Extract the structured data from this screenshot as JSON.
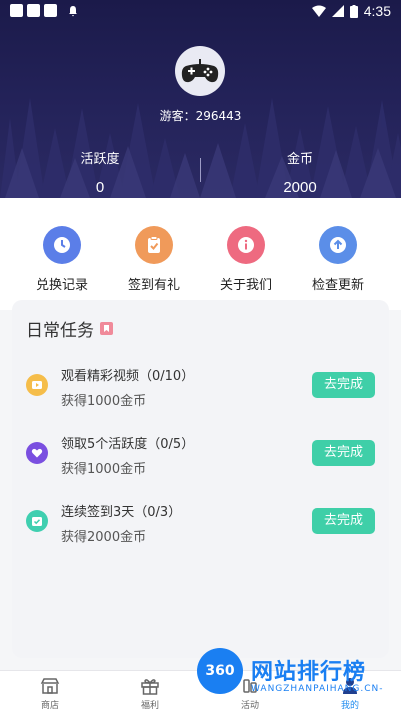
{
  "status_bar": {
    "time": "4:35"
  },
  "profile": {
    "guest_label": "游客：296443"
  },
  "stats": {
    "activity_label": "活跃度",
    "activity_value": "0",
    "coins_label": "金币",
    "coins_value": "2000"
  },
  "quick_actions": [
    {
      "label": "兑换记录",
      "icon": "clock-icon",
      "color": "#5b7ee8"
    },
    {
      "label": "签到有礼",
      "icon": "clipboard-check-icon",
      "color": "#f09a5a"
    },
    {
      "label": "关于我们",
      "icon": "info-icon",
      "color": "#ee6a80"
    },
    {
      "label": "检查更新",
      "icon": "upload-icon",
      "color": "#5b8ee8"
    }
  ],
  "daily_tasks": {
    "title": "日常任务",
    "items": [
      {
        "title": "观看精彩视频（0/10）",
        "reward": "获得1000金币",
        "button": "去完成",
        "icon": "video-play-icon",
        "color": "#f5bd4a"
      },
      {
        "title": "领取5个活跃度（0/5）",
        "reward": "获得1000金币",
        "button": "去完成",
        "icon": "heart-icon",
        "color": "#7a4fe0"
      },
      {
        "title": "连续签到3天（0/3）",
        "reward": "获得2000金币",
        "button": "去完成",
        "icon": "calendar-check-icon",
        "color": "#3fcfb0"
      }
    ]
  },
  "bottom_nav": [
    {
      "label": "商店",
      "icon": "store-icon"
    },
    {
      "label": "福利",
      "icon": "gift-icon"
    },
    {
      "label": "活动",
      "icon": "activity-icon"
    },
    {
      "label": "我的",
      "icon": "profile-icon"
    }
  ],
  "watermark": {
    "badge": "360",
    "name": "网站排行榜",
    "url": "WANGZHANPAIHANG.CN-"
  },
  "colors": {
    "header_bg": "#1b1a4a",
    "accent_green": "#3fcfa8",
    "nav_active": "#1f8cf0"
  }
}
